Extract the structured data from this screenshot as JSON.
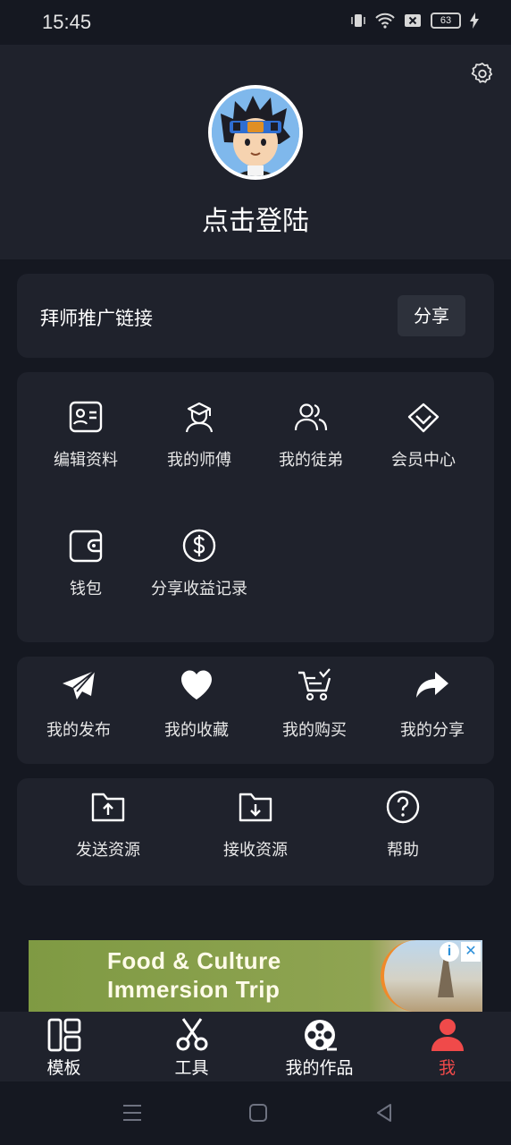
{
  "status": {
    "time": "15:45",
    "battery": "63"
  },
  "profile": {
    "login_text": "点击登陆"
  },
  "promo": {
    "label": "拜师推广链接",
    "share_button": "分享"
  },
  "menu_grid": [
    {
      "label": "编辑资料",
      "icon": "id-card-icon"
    },
    {
      "label": "我的师傅",
      "icon": "teacher-icon"
    },
    {
      "label": "我的徒弟",
      "icon": "users-icon"
    },
    {
      "label": "会员中心",
      "icon": "diamond-icon"
    },
    {
      "label": "钱包",
      "icon": "wallet-icon"
    },
    {
      "label": "分享收益记录",
      "icon": "dollar-icon"
    }
  ],
  "actions": [
    {
      "label": "我的发布",
      "icon": "send-icon"
    },
    {
      "label": "我的收藏",
      "icon": "heart-icon"
    },
    {
      "label": "我的购买",
      "icon": "cart-icon"
    },
    {
      "label": "我的分享",
      "icon": "share-arrow-icon"
    }
  ],
  "resources": [
    {
      "label": "发送资源",
      "icon": "folder-upload-icon"
    },
    {
      "label": "接收资源",
      "icon": "folder-download-icon"
    },
    {
      "label": "帮助",
      "icon": "help-icon"
    }
  ],
  "ad": {
    "line1": "Food & Culture",
    "line2": "Immersion Trip",
    "info": "i",
    "close": "✕"
  },
  "tabs": [
    {
      "label": "模板",
      "icon": "template-icon"
    },
    {
      "label": "工具",
      "icon": "scissors-icon"
    },
    {
      "label": "我的作品",
      "icon": "film-reel-icon"
    },
    {
      "label": "我",
      "icon": "user-icon",
      "active": true
    }
  ],
  "colors": {
    "background": "#151821",
    "card": "#1f222c",
    "accent": "#f04a4a",
    "button": "#2d313b"
  }
}
